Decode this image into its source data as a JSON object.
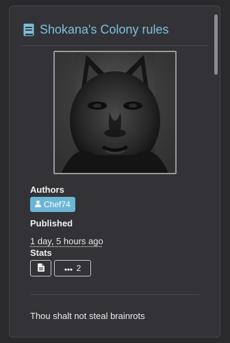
{
  "post": {
    "title": "Shokana's Colony rules",
    "icon": "book-icon",
    "image_alt": "grayscale cat with a human face",
    "authors_label": "Authors",
    "author_name": "Chef74",
    "published_label": "Published",
    "published_value": "1 day, 5 hours ago",
    "stats_label": "Stats",
    "comment_count": "2",
    "body": "Thou shalt not steal brainrots"
  },
  "colors": {
    "accent": "#7cc0de",
    "badge": "#6bb6d6",
    "background": "#2a2a2d",
    "card": "#333337"
  }
}
